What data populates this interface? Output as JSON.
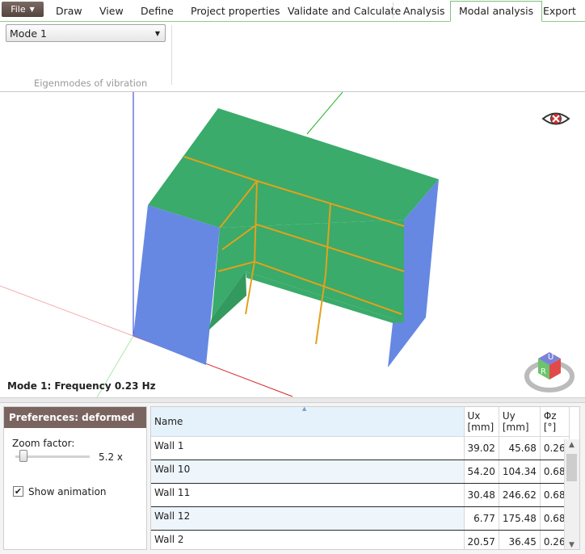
{
  "menu": {
    "file_label": "File",
    "tabs": [
      "Draw",
      "View",
      "Define",
      "Project properties",
      "Validate and Calculate",
      "Analysis",
      "Modal analysis",
      "Export"
    ],
    "active_tab": "Modal analysis"
  },
  "ribbon": {
    "mode_selected": "Mode 1",
    "group_label": "Eigenmodes of vibration"
  },
  "viewport": {
    "caption": "Mode 1: Frequency 0.23 Hz",
    "colors": {
      "slab": "#3aab6a",
      "wall": "#6688e3",
      "beam": "#e1a21c",
      "axis_x": "#d9252a",
      "axis_y": "#22b322",
      "axis_z": "#2233cc"
    },
    "view_cube_letters": [
      "U",
      "R"
    ]
  },
  "preferences": {
    "header": "Preferences: deformed view",
    "zoom_label": "Zoom factor:",
    "zoom_value": "5.2 x",
    "zoom_level": 0.05,
    "show_animation_label": "Show animation",
    "show_animation_checked": true
  },
  "table": {
    "headers": {
      "name": "Name",
      "ux": [
        "Ux",
        "[mm]"
      ],
      "uy": [
        "Uy",
        "[mm]"
      ],
      "phiz": [
        "Φz",
        "[°]"
      ]
    },
    "rows": [
      {
        "name": "Wall 1",
        "ux": "39.02",
        "uy": "45.68",
        "phiz": "0.26"
      },
      {
        "name": "Wall 10",
        "ux": "54.20",
        "uy": "104.34",
        "phiz": "0.68"
      },
      {
        "name": "Wall 11",
        "ux": "30.48",
        "uy": "246.62",
        "phiz": "0.68"
      },
      {
        "name": "Wall 12",
        "ux": "6.77",
        "uy": "175.48",
        "phiz": "0.68"
      },
      {
        "name": "Wall 2",
        "ux": "20.57",
        "uy": "36.45",
        "phiz": "0.26"
      }
    ]
  }
}
